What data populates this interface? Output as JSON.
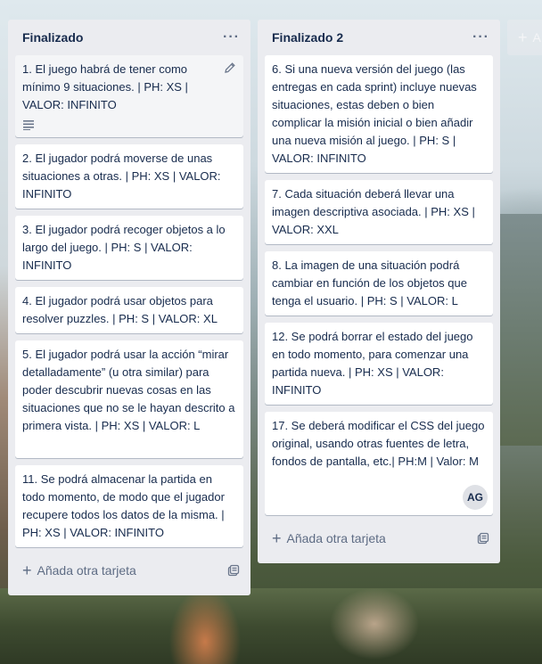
{
  "lists": [
    {
      "title": "Finalizado",
      "cards": [
        "1. El juego habrá de tener como mínimo 9 situaciones. | PH: XS | VALOR: INFINITO",
        "2. El jugador podrá moverse de unas situaciones a otras. | PH: XS | VALOR: INFINITO",
        "3. El jugador podrá recoger objetos a lo largo del juego. | PH: S | VALOR: INFINITO",
        "4. El jugador podrá usar objetos para resolver puzzles. | PH: S | VALOR: XL",
        "5. El jugador podrá usar la acción “mirar detalladamente” (u otra similar) para poder descubrir nuevas cosas en las situaciones que no se le hayan descrito a primera vista. | PH: XS | VALOR: L",
        "11. Se podrá almacenar la partida en todo momento, de modo que el jugador recupere todos los datos de la misma. | PH: XS | VALOR: INFINITO"
      ],
      "add_card_label": "Añada otra tarjeta"
    },
    {
      "title": "Finalizado 2",
      "cards": [
        "6. Si una nueva versión del juego (las entregas en cada sprint) incluye nuevas situaciones, estas deben o bien complicar la misión inicial o bien añadir una nueva misión al juego. | PH: S | VALOR: INFINITO",
        "7. Cada situación deberá llevar una imagen descriptiva asociada. | PH: XS | VALOR: XXL",
        "8. La imagen de una situación podrá cambiar en función de los objetos que tenga el usuario. | PH: S | VALOR: L",
        "12. Se podrá borrar el estado del juego en todo momento, para comenzar una partida nueva. | PH: XS | VALOR: INFINITO",
        "17. Se deberá modificar el CSS del juego original, usando otras fuentes de letra, fondos de pantalla, etc.| PH:M | Valor: M"
      ],
      "avatar": "AG",
      "add_card_label": "Añada otra tarjeta"
    }
  ],
  "add_list_label": "A",
  "menu_glyph": "···",
  "icons": [
    "pencil-icon",
    "description-icon",
    "plus-icon",
    "template-icon",
    "ellipsis-icon"
  ]
}
